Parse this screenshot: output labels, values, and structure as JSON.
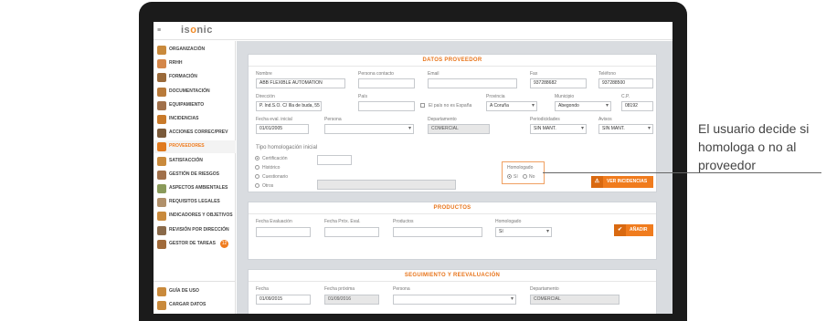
{
  "app": {
    "logo_prefix": "is",
    "logo_mark": "o",
    "logo_suffix": "nic",
    "menu_glyph": "≡"
  },
  "sidebar": {
    "items": [
      {
        "label": "ORGANIZACIÓN",
        "icon": "organization-icon"
      },
      {
        "label": "RRHH",
        "icon": "hr-icon"
      },
      {
        "label": "FORMACIÓN",
        "icon": "training-icon"
      },
      {
        "label": "DOCUMENTACIÓN",
        "icon": "documents-icon"
      },
      {
        "label": "EQUIPAMIENTO",
        "icon": "equipment-icon"
      },
      {
        "label": "INCIDENCIAS",
        "icon": "incidents-icon"
      },
      {
        "label": "ACCIONES CORREC/PREV",
        "icon": "actions-icon"
      },
      {
        "label": "PROVEEDORES",
        "icon": "suppliers-icon"
      },
      {
        "label": "SATISFACCIÓN",
        "icon": "satisfaction-icon"
      },
      {
        "label": "GESTIÓN DE RIESGOS",
        "icon": "risk-icon"
      },
      {
        "label": "ASPECTOS AMBIENTALES",
        "icon": "environment-icon"
      },
      {
        "label": "REQUISITOS LEGALES",
        "icon": "legal-icon"
      },
      {
        "label": "INDICADORES Y OBJETIVOS",
        "icon": "indicators-icon"
      },
      {
        "label": "REVISIÓN POR DIRECCIÓN",
        "icon": "review-icon"
      },
      {
        "label": "GESTOR DE TAREAS",
        "icon": "tasks-icon",
        "badge": "12"
      }
    ],
    "footer": [
      {
        "label": "GUÍA DE USO",
        "icon": "guide-icon"
      },
      {
        "label": "CARGAR DATOS",
        "icon": "upload-icon"
      },
      {
        "label": "SALIR",
        "icon": "power-icon"
      }
    ],
    "active_index": 7
  },
  "proveedor": {
    "title": "DATOS PROVEEDOR",
    "labels": {
      "nombre": "Nombre",
      "contacto": "Persona contacto",
      "email": "Email",
      "fax": "Fax",
      "telefono": "Teléfono",
      "direccion": "Dirección",
      "pais": "País",
      "provincia": "Provincia",
      "municipio": "Municipio",
      "cp": "C.P.",
      "fecha_eval": "Fecha eval. inicial",
      "persona": "Persona",
      "departamento": "Departamento",
      "periodicidades": "Periodicidades",
      "avisos": "Avisos",
      "pais_no_espana": "El país no es España",
      "tipo_homologacion": "Tipo homologación inicial",
      "homologado": "Homologado"
    },
    "values": {
      "nombre": "ABB FLEXIBLE AUTOMATION",
      "contacto": "",
      "email": "",
      "fax": "937288682",
      "telefono": "937288500",
      "direccion": "P. Ind.S.O. C/ Illa de buda, 55",
      "pais": "",
      "provincia": "A Coruña",
      "municipio": "Abegondo",
      "cp": "08192",
      "fecha_eval": "01/01/2005",
      "persona": "",
      "departamento": "COMERCIAL",
      "periodicidades": "SIN MANT.",
      "avisos": "SIN MANT."
    },
    "tipo_options": [
      "Certificación",
      "Histórico",
      "Cuestionario",
      "Otros"
    ],
    "homologado_si": "Sí",
    "homologado_no": "No",
    "button_label": "VER INCIDENCIAS",
    "button_icon": "⚠"
  },
  "productos": {
    "title": "PRODUCTOS",
    "labels": {
      "fecha_evaluacion": "Fecha Evaluación",
      "fecha_prox": "Fecha Próx. Eval.",
      "productos": "Productos",
      "homologado": "Homologado"
    },
    "values": {
      "homologado": "Sí"
    },
    "button_label": "AÑADIR",
    "button_icon": "✔"
  },
  "seguimiento": {
    "title": "SEGUIMIENTO Y REEVALUACIÓN",
    "labels": {
      "fecha": "Fecha",
      "fecha_proxima": "Fecha próxima",
      "persona": "Persona",
      "departamento": "Departamento"
    },
    "values": {
      "fecha": "01/09/2015",
      "fecha_proxima": "01/09/2016",
      "departamento": "COMERCIAL"
    }
  },
  "annotation": {
    "text": "El usuario decide si homologa o no al proveedor"
  }
}
